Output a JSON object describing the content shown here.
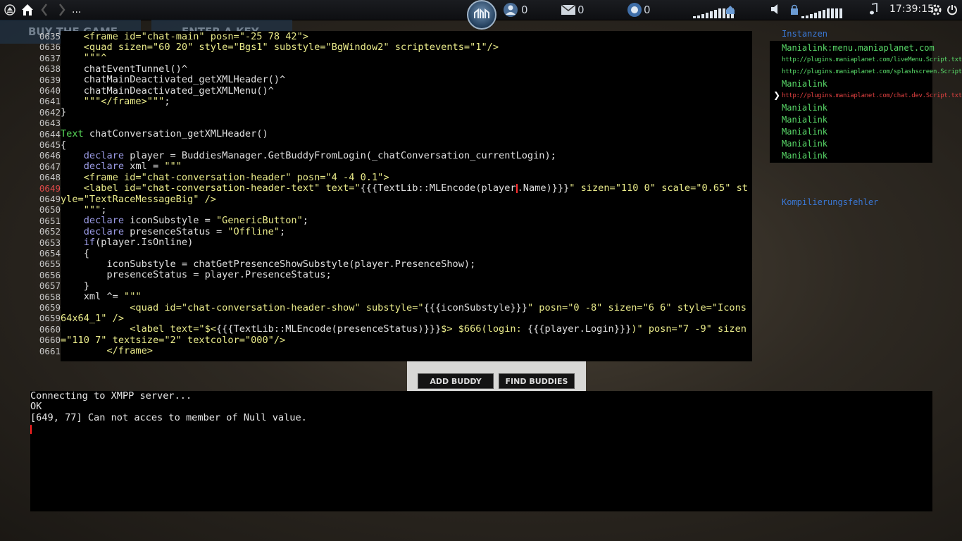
{
  "topbar": {
    "breadcrumb": "...",
    "buddies_count": "0",
    "messages_count": "0",
    "notifications_count": "0",
    "clock": "17:39:15"
  },
  "background": {
    "menu_left": "BUY THE GAME",
    "menu_right": "ENTER A KEY"
  },
  "editor": {
    "current_line": "0649",
    "lines": [
      {
        "ln": "0635",
        "parts": [
          [
            "t",
            "    "
          ],
          [
            "s",
            "<frame id=\"chat-main\" posn=\"-25 78 42\">"
          ]
        ]
      },
      {
        "ln": "0636",
        "parts": [
          [
            "t",
            "    "
          ],
          [
            "s",
            "<quad sizen=\"60 20\" style=\"Bgs1\" substyle=\"BgWindow2\" scriptevents=\"1\"/>"
          ]
        ]
      },
      {
        "ln": "0637",
        "parts": [
          [
            "t",
            "    "
          ],
          [
            "s",
            "\"\"\"^"
          ]
        ]
      },
      {
        "ln": "0638",
        "parts": [
          [
            "t",
            "    chatEventTunnel()^"
          ]
        ]
      },
      {
        "ln": "0639",
        "parts": [
          [
            "t",
            "    chatMainDeactivated_getXMLHeader()^"
          ]
        ]
      },
      {
        "ln": "0640",
        "parts": [
          [
            "t",
            "    chatMainDeactivated_getXMLMenu()^"
          ]
        ]
      },
      {
        "ln": "0641",
        "parts": [
          [
            "t",
            "    "
          ],
          [
            "s",
            "\"\"\"</frame>\"\"\""
          ],
          [
            "t",
            ";"
          ]
        ]
      },
      {
        "ln": "0642",
        "parts": [
          [
            "t",
            "}"
          ]
        ]
      },
      {
        "ln": "0643",
        "parts": [
          [
            "t",
            ""
          ]
        ]
      },
      {
        "ln": "0644",
        "parts": [
          [
            "y",
            "Text"
          ],
          [
            "t",
            " chatConversation_getXMLHeader()"
          ]
        ]
      },
      {
        "ln": "0645",
        "parts": [
          [
            "t",
            "{"
          ]
        ]
      },
      {
        "ln": "0646",
        "parts": [
          [
            "t",
            "    "
          ],
          [
            "k",
            "declare"
          ],
          [
            "t",
            " player = BuddiesManager.GetBuddyFromLogin(_chatConversation_currentLogin);"
          ]
        ]
      },
      {
        "ln": "0647",
        "parts": [
          [
            "t",
            "    "
          ],
          [
            "k",
            "declare"
          ],
          [
            "t",
            " xml = "
          ],
          [
            "s",
            "\"\"\""
          ]
        ]
      },
      {
        "ln": "0648",
        "parts": [
          [
            "t",
            "    "
          ],
          [
            "s",
            "<frame id=\"chat-conversation-header\" posn=\"4 -4 0.1\">"
          ]
        ]
      },
      {
        "ln": "0649",
        "parts": [
          [
            "t",
            "    "
          ],
          [
            "s",
            "<label id=\"chat-conversation-header-text\" text=\""
          ],
          [
            "t",
            "{{{TextLib::MLEncode(player"
          ],
          [
            "c",
            ""
          ],
          [
            "t",
            ".Name)}}}"
          ],
          [
            "s",
            "\" sizen=\"110 0\" scale=\"0.65\" st"
          ]
        ]
      },
      {
        "ln": "0649",
        "parts": [
          [
            "s",
            "yle=\"TextRaceMessageBig\" />"
          ]
        ]
      },
      {
        "ln": "0650",
        "parts": [
          [
            "t",
            "    "
          ],
          [
            "s",
            "\"\"\""
          ],
          [
            "t",
            ";"
          ]
        ]
      },
      {
        "ln": "0651",
        "parts": [
          [
            "t",
            "    "
          ],
          [
            "k",
            "declare"
          ],
          [
            "t",
            " iconSubstyle = "
          ],
          [
            "s",
            "\"GenericButton\""
          ],
          [
            "t",
            ";"
          ]
        ]
      },
      {
        "ln": "0652",
        "parts": [
          [
            "t",
            "    "
          ],
          [
            "k",
            "declare"
          ],
          [
            "t",
            " presenceStatus = "
          ],
          [
            "s",
            "\"Offline\""
          ],
          [
            "t",
            ";"
          ]
        ]
      },
      {
        "ln": "0653",
        "parts": [
          [
            "t",
            "    "
          ],
          [
            "k",
            "if"
          ],
          [
            "t",
            "(player.IsOnline)"
          ]
        ]
      },
      {
        "ln": "0654",
        "parts": [
          [
            "t",
            "    {"
          ]
        ]
      },
      {
        "ln": "0655",
        "parts": [
          [
            "t",
            "        iconSubstyle = chatGetPresenceShowSubstyle(player.PresenceShow);"
          ]
        ]
      },
      {
        "ln": "0656",
        "parts": [
          [
            "t",
            "        presenceStatus = player.PresenceStatus;"
          ]
        ]
      },
      {
        "ln": "0657",
        "parts": [
          [
            "t",
            "    }"
          ]
        ]
      },
      {
        "ln": "0658",
        "parts": [
          [
            "t",
            "    xml ^= "
          ],
          [
            "s",
            "\"\"\""
          ]
        ]
      },
      {
        "ln": "0659",
        "parts": [
          [
            "t",
            "            "
          ],
          [
            "s",
            "<quad id=\"chat-conversation-header-show\" substyle=\""
          ],
          [
            "t",
            "{{{iconSubstyle}}}"
          ],
          [
            "s",
            "\" posn=\"0 -8\" sizen=\"6 6\" style=\"Icons"
          ]
        ]
      },
      {
        "ln": "0659",
        "parts": [
          [
            "s",
            "64x64_1\" />"
          ]
        ]
      },
      {
        "ln": "0660",
        "parts": [
          [
            "t",
            "            "
          ],
          [
            "s",
            "<label text=\"$<"
          ],
          [
            "t",
            "{{{TextLib::MLEncode(presenceStatus)}}}"
          ],
          [
            "s",
            "$> $666(login: "
          ],
          [
            "t",
            "{{{player.Login}}}"
          ],
          [
            "s",
            ")\" posn=\"7 -9\" sizen"
          ]
        ]
      },
      {
        "ln": "0660",
        "parts": [
          [
            "s",
            "=\"110 7\" textsize=\"2\" textcolor=\"000\"/>"
          ]
        ]
      },
      {
        "ln": "0661",
        "parts": [
          [
            "t",
            "        "
          ],
          [
            "s",
            "</frame>"
          ]
        ]
      }
    ]
  },
  "side": {
    "instances_label": "Instanzen",
    "instances": [
      {
        "text": "Manialink:menu.maniaplanet.com",
        "style": "normal"
      },
      {
        "text": "http://plugins.maniaplanet.com/liveMenu.Script.txt",
        "style": "small"
      },
      {
        "text": "http://plugins.maniaplanet.com/splashscreen.Script.txt",
        "style": "small"
      },
      {
        "text": "Manialink",
        "style": "normal"
      },
      {
        "text": "http://plugins.maniaplanet.com/chat.dev.Script.txt",
        "style": "small-red"
      },
      {
        "text": "Manialink",
        "style": "normal"
      },
      {
        "text": "Manialink",
        "style": "normal"
      },
      {
        "text": "Manialink",
        "style": "normal"
      },
      {
        "text": "Manialink",
        "style": "normal"
      },
      {
        "text": "Manialink",
        "style": "normal"
      }
    ],
    "selected_index": 4,
    "errors_label": "Kompilierungsfehler"
  },
  "buddies": {
    "add_label": "ADD BUDDY",
    "find_label": "FIND BUDDIES"
  },
  "console": {
    "lines": [
      "Connecting to XMPP server...",
      "OK",
      "[649, 77] Can not acces to member of Null value."
    ]
  },
  "colors": {
    "keyword": "#9d9de8",
    "string": "#eaeb8a",
    "type": "#57d657",
    "instance_green": "#5adc6a",
    "instance_red": "#e04040",
    "label_blue": "#3a78d6"
  }
}
